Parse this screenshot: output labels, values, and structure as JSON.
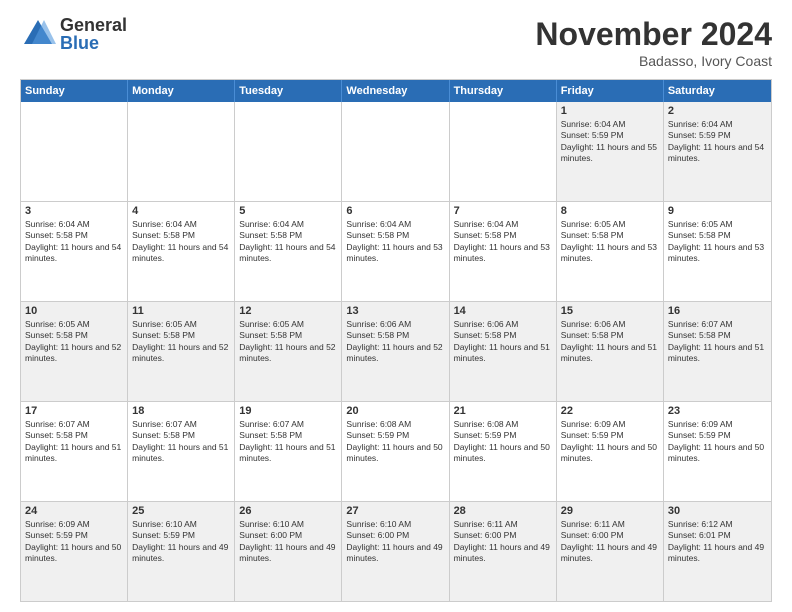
{
  "logo": {
    "general": "General",
    "blue": "Blue"
  },
  "title": "November 2024",
  "location": "Badasso, Ivory Coast",
  "days_of_week": [
    "Sunday",
    "Monday",
    "Tuesday",
    "Wednesday",
    "Thursday",
    "Friday",
    "Saturday"
  ],
  "rows": [
    [
      {
        "day": "",
        "info": ""
      },
      {
        "day": "",
        "info": ""
      },
      {
        "day": "",
        "info": ""
      },
      {
        "day": "",
        "info": ""
      },
      {
        "day": "",
        "info": ""
      },
      {
        "day": "1",
        "info": "Sunrise: 6:04 AM\nSunset: 5:59 PM\nDaylight: 11 hours and 55 minutes."
      },
      {
        "day": "2",
        "info": "Sunrise: 6:04 AM\nSunset: 5:59 PM\nDaylight: 11 hours and 54 minutes."
      }
    ],
    [
      {
        "day": "3",
        "info": "Sunrise: 6:04 AM\nSunset: 5:58 PM\nDaylight: 11 hours and 54 minutes."
      },
      {
        "day": "4",
        "info": "Sunrise: 6:04 AM\nSunset: 5:58 PM\nDaylight: 11 hours and 54 minutes."
      },
      {
        "day": "5",
        "info": "Sunrise: 6:04 AM\nSunset: 5:58 PM\nDaylight: 11 hours and 54 minutes."
      },
      {
        "day": "6",
        "info": "Sunrise: 6:04 AM\nSunset: 5:58 PM\nDaylight: 11 hours and 53 minutes."
      },
      {
        "day": "7",
        "info": "Sunrise: 6:04 AM\nSunset: 5:58 PM\nDaylight: 11 hours and 53 minutes."
      },
      {
        "day": "8",
        "info": "Sunrise: 6:05 AM\nSunset: 5:58 PM\nDaylight: 11 hours and 53 minutes."
      },
      {
        "day": "9",
        "info": "Sunrise: 6:05 AM\nSunset: 5:58 PM\nDaylight: 11 hours and 53 minutes."
      }
    ],
    [
      {
        "day": "10",
        "info": "Sunrise: 6:05 AM\nSunset: 5:58 PM\nDaylight: 11 hours and 52 minutes."
      },
      {
        "day": "11",
        "info": "Sunrise: 6:05 AM\nSunset: 5:58 PM\nDaylight: 11 hours and 52 minutes."
      },
      {
        "day": "12",
        "info": "Sunrise: 6:05 AM\nSunset: 5:58 PM\nDaylight: 11 hours and 52 minutes."
      },
      {
        "day": "13",
        "info": "Sunrise: 6:06 AM\nSunset: 5:58 PM\nDaylight: 11 hours and 52 minutes."
      },
      {
        "day": "14",
        "info": "Sunrise: 6:06 AM\nSunset: 5:58 PM\nDaylight: 11 hours and 51 minutes."
      },
      {
        "day": "15",
        "info": "Sunrise: 6:06 AM\nSunset: 5:58 PM\nDaylight: 11 hours and 51 minutes."
      },
      {
        "day": "16",
        "info": "Sunrise: 6:07 AM\nSunset: 5:58 PM\nDaylight: 11 hours and 51 minutes."
      }
    ],
    [
      {
        "day": "17",
        "info": "Sunrise: 6:07 AM\nSunset: 5:58 PM\nDaylight: 11 hours and 51 minutes."
      },
      {
        "day": "18",
        "info": "Sunrise: 6:07 AM\nSunset: 5:58 PM\nDaylight: 11 hours and 51 minutes."
      },
      {
        "day": "19",
        "info": "Sunrise: 6:07 AM\nSunset: 5:58 PM\nDaylight: 11 hours and 51 minutes."
      },
      {
        "day": "20",
        "info": "Sunrise: 6:08 AM\nSunset: 5:59 PM\nDaylight: 11 hours and 50 minutes."
      },
      {
        "day": "21",
        "info": "Sunrise: 6:08 AM\nSunset: 5:59 PM\nDaylight: 11 hours and 50 minutes."
      },
      {
        "day": "22",
        "info": "Sunrise: 6:09 AM\nSunset: 5:59 PM\nDaylight: 11 hours and 50 minutes."
      },
      {
        "day": "23",
        "info": "Sunrise: 6:09 AM\nSunset: 5:59 PM\nDaylight: 11 hours and 50 minutes."
      }
    ],
    [
      {
        "day": "24",
        "info": "Sunrise: 6:09 AM\nSunset: 5:59 PM\nDaylight: 11 hours and 50 minutes."
      },
      {
        "day": "25",
        "info": "Sunrise: 6:10 AM\nSunset: 5:59 PM\nDaylight: 11 hours and 49 minutes."
      },
      {
        "day": "26",
        "info": "Sunrise: 6:10 AM\nSunset: 6:00 PM\nDaylight: 11 hours and 49 minutes."
      },
      {
        "day": "27",
        "info": "Sunrise: 6:10 AM\nSunset: 6:00 PM\nDaylight: 11 hours and 49 minutes."
      },
      {
        "day": "28",
        "info": "Sunrise: 6:11 AM\nSunset: 6:00 PM\nDaylight: 11 hours and 49 minutes."
      },
      {
        "day": "29",
        "info": "Sunrise: 6:11 AM\nSunset: 6:00 PM\nDaylight: 11 hours and 49 minutes."
      },
      {
        "day": "30",
        "info": "Sunrise: 6:12 AM\nSunset: 6:01 PM\nDaylight: 11 hours and 49 minutes."
      }
    ]
  ]
}
